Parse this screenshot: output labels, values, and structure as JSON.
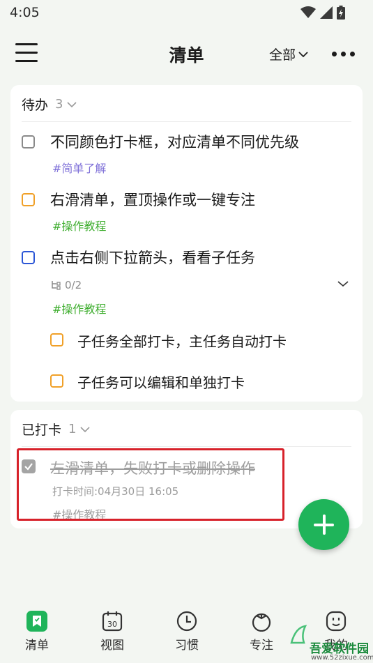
{
  "status": {
    "time": "4:05"
  },
  "header": {
    "title": "清单",
    "filter_label": "全部"
  },
  "todo_section": {
    "label": "待办",
    "count": "3",
    "tasks": [
      {
        "title": "不同颜色打卡框，对应清单不同优先级",
        "tag": "#简单了解",
        "checkbox_color": "#8a8a8a",
        "tag_color": "#7e6fd8"
      },
      {
        "title": "右滑清单，置顶操作或一键专注",
        "tag": "#操作教程",
        "checkbox_color": "#f0a028",
        "tag_color": "#3fae2f"
      },
      {
        "title": "点击右侧下拉箭头，看看子任务",
        "subtask_progress": "0/2",
        "tag": "#操作教程",
        "checkbox_color": "#2b56d6",
        "tag_color": "#3fae2f"
      }
    ],
    "subtasks": [
      {
        "title": "子任务全部打卡，主任务自动打卡",
        "checkbox_color": "#f0a028"
      },
      {
        "title": "子任务可以编辑和单独打卡",
        "checkbox_color": "#f0a028"
      }
    ]
  },
  "done_section": {
    "label": "已打卡",
    "count": "1",
    "task": {
      "title": "左滑清单，失败打卡或删除操作",
      "time": "打卡时间:04月30日 16:05",
      "tag": "#操作教程"
    }
  },
  "bottom_nav": [
    {
      "label": "清单",
      "icon": "list-bookmark-icon",
      "active": true
    },
    {
      "label": "视图",
      "icon": "calendar-icon",
      "calendar_number": "30"
    },
    {
      "label": "习惯",
      "icon": "clock-icon"
    },
    {
      "label": "专注",
      "icon": "tomato-icon"
    },
    {
      "label": "我的",
      "icon": "face-icon"
    }
  ],
  "watermark": {
    "text": "吾爱软件园",
    "url": "www.52zixue.com"
  },
  "colors": {
    "accent": "#1fb45a",
    "highlight": "#d7212a"
  }
}
